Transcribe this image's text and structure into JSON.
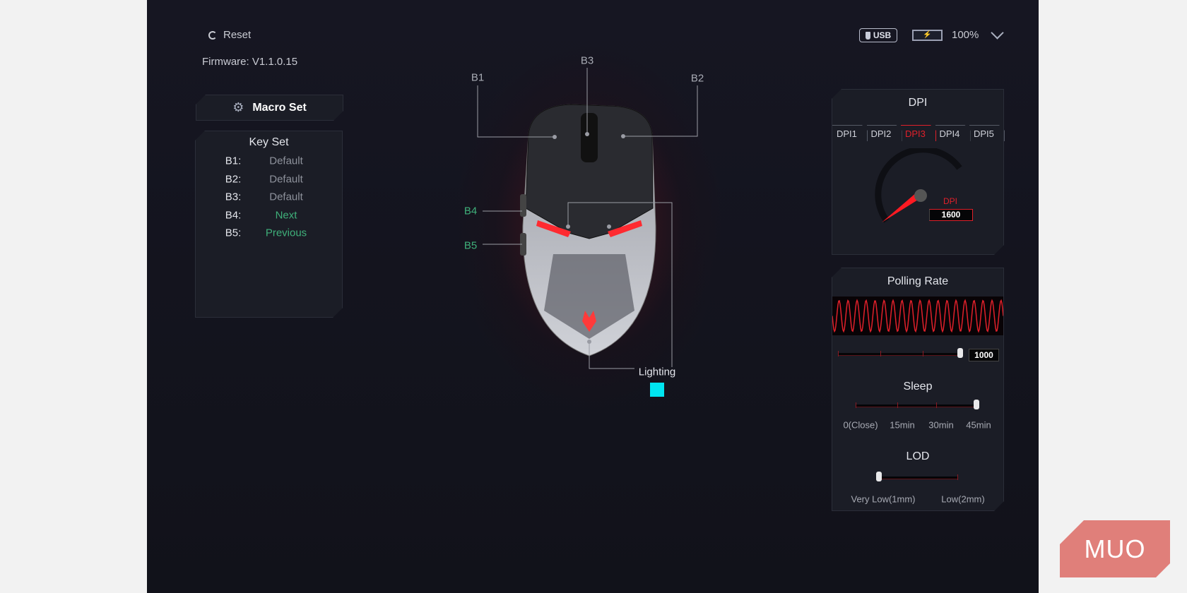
{
  "header": {
    "reset_label": "Reset",
    "firmware": "Firmware: V1.1.0.15",
    "connection": "USB",
    "battery_percent": "100%",
    "icons": {
      "reset": "refresh-icon",
      "connection": "usb-icon",
      "battery": "battery-charging-icon",
      "menu": "chevron-down-icon"
    }
  },
  "macro": {
    "label": "Macro Set",
    "icon": "gear-icon"
  },
  "key_set": {
    "title": "Key Set",
    "rows": [
      {
        "key": "B1:",
        "value": "Default"
      },
      {
        "key": "B2:",
        "value": "Default"
      },
      {
        "key": "B3:",
        "value": "Default"
      },
      {
        "key": "B4:",
        "value": "Next"
      },
      {
        "key": "B5:",
        "value": "Previous"
      }
    ]
  },
  "mouse": {
    "labels": {
      "b1": "B1",
      "b2": "B2",
      "b3": "B3",
      "b4": "B4",
      "b5": "B5"
    },
    "lighting_label": "Lighting",
    "lighting_color": "#00e5f0"
  },
  "dpi": {
    "title": "DPI",
    "tabs": [
      "DPI1",
      "DPI2",
      "DPI3",
      "DPI4",
      "DPI5"
    ],
    "active_tab": "DPI3",
    "gauge_label": "DPI",
    "value": "1600"
  },
  "polling": {
    "title": "Polling Rate",
    "value": "1000",
    "level": 1.0
  },
  "sleep": {
    "title": "Sleep",
    "options": [
      "0(Close)",
      "15min",
      "30min",
      "45min"
    ],
    "selected": "45min"
  },
  "lod": {
    "title": "LOD",
    "options": [
      "Very Low(1mm)",
      "Low(2mm)"
    ],
    "selected": "Very Low(1mm)"
  },
  "colors": {
    "accent": "#e0202a",
    "green": "#3fb07a",
    "panel": "#1b1d26"
  },
  "watermark": "MUO"
}
